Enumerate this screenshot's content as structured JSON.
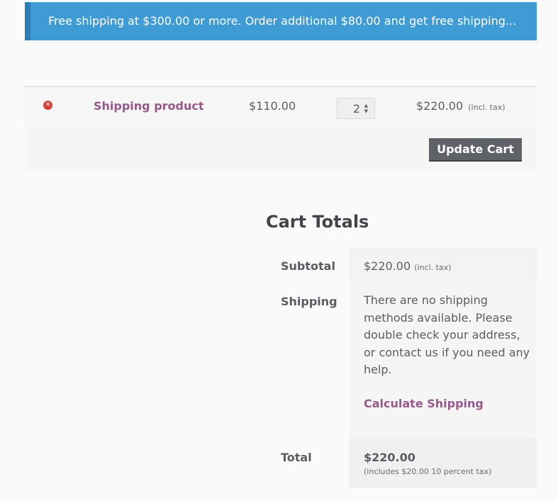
{
  "notice": {
    "text": "Free shipping at $300.00 or more. Order additional $80.00 and get free shipping..."
  },
  "cart": {
    "remove_icon": "remove-icon",
    "product_name": "Shipping product",
    "price": "$110.00",
    "quantity": "2",
    "line_total": "$220.00",
    "line_total_tax": "(incl. tax)",
    "update_label": "Update Cart"
  },
  "totals": {
    "title": "Cart Totals",
    "subtotal_label": "Subtotal",
    "subtotal_value": "$220.00",
    "subtotal_tax": "(incl. tax)",
    "shipping_label": "Shipping",
    "shipping_message": "There are no shipping methods available. Please double check your address, or contact us if you need any help.",
    "calculate_shipping": "Calculate Shipping",
    "total_label": "Total",
    "total_value": "$220.00",
    "total_tax_note": "(includes $20.00 10 percent tax)"
  },
  "colors": {
    "notice_bg": "#3e9bd4",
    "link": "#96588a",
    "button": "#5f6169",
    "remove": "#d43f3a"
  }
}
